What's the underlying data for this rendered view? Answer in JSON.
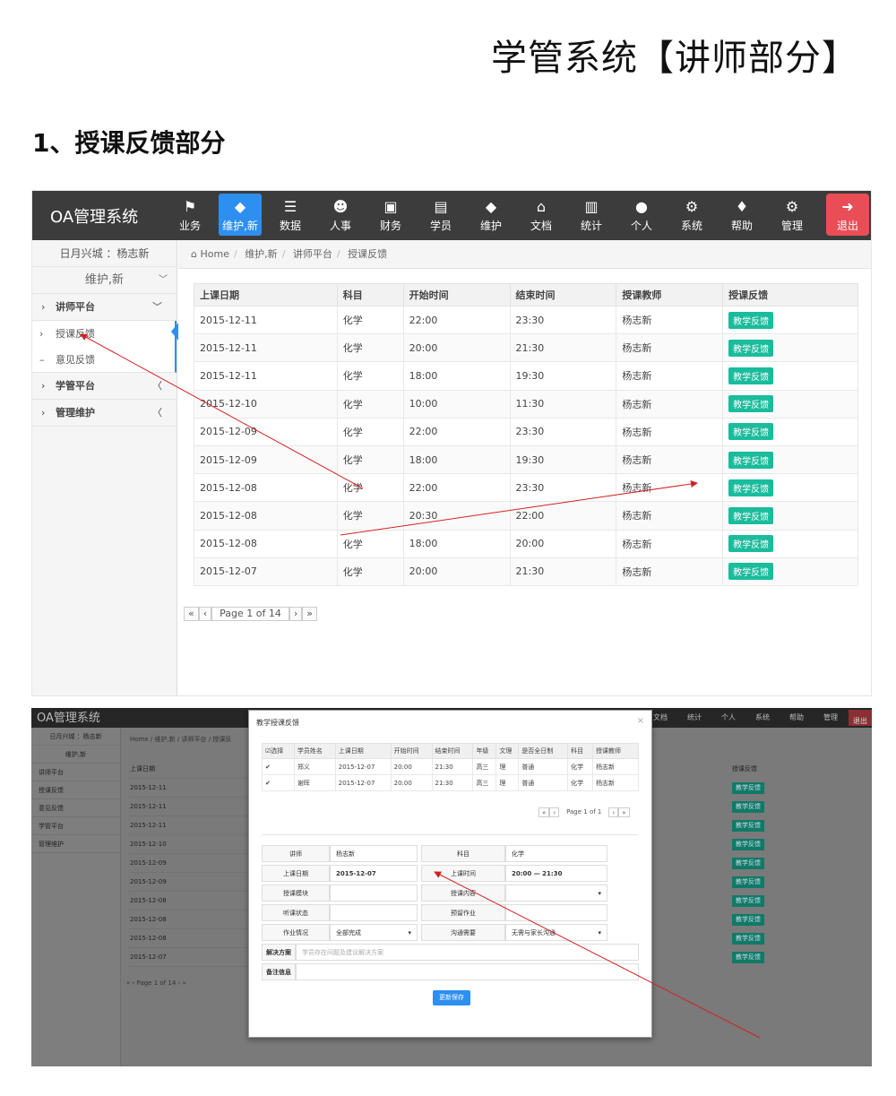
{
  "doc": {
    "title": "学管系统【讲师部分】",
    "section_heading": "1、授课反馈部分"
  },
  "app": {
    "brand": "OA管理系统",
    "nav": [
      {
        "label": "业务",
        "icon": "flag-icon",
        "glyph": "⚑"
      },
      {
        "label": "维护,新",
        "icon": "tag-icon",
        "glyph": "◆"
      },
      {
        "label": "数据",
        "icon": "server-icon",
        "glyph": "☰"
      },
      {
        "label": "人事",
        "icon": "users-icon",
        "glyph": "☻"
      },
      {
        "label": "财务",
        "icon": "money-icon",
        "glyph": "▣"
      },
      {
        "label": "学员",
        "icon": "book-icon",
        "glyph": "▤"
      },
      {
        "label": "维护",
        "icon": "tag-icon",
        "glyph": "◆"
      },
      {
        "label": "文档",
        "icon": "inbox-icon",
        "glyph": "⌂"
      },
      {
        "label": "统计",
        "icon": "bar-chart-icon",
        "glyph": "▥"
      },
      {
        "label": "个人",
        "icon": "user-icon",
        "glyph": "●"
      },
      {
        "label": "系统",
        "icon": "cogs-icon",
        "glyph": "⚙"
      },
      {
        "label": "帮助",
        "icon": "drop-icon",
        "glyph": "♦"
      },
      {
        "label": "管理",
        "icon": "cogs-icon",
        "glyph": "⚙"
      },
      {
        "label": "退出",
        "icon": "sign-out-icon",
        "glyph": "➜"
      }
    ],
    "active_nav": "维护,新",
    "accent_color": "#2d8ff0",
    "exit_color": "#e94e57",
    "feedback_button_color": "#1abc9c",
    "sidebar": {
      "user": "日月兴城 ：杨志新",
      "section": "维护,新",
      "groups": [
        {
          "label": "讲师平台",
          "chevron": "﹀"
        },
        {
          "label": "学管平台",
          "chevron": "〈"
        },
        {
          "label": "管理维护",
          "chevron": "〈"
        }
      ],
      "sub_items": [
        "授课反馈",
        "意见反馈"
      ]
    },
    "breadcrumb": [
      "Home",
      "维护,新",
      "讲师平台",
      "授课反馈"
    ]
  },
  "feedback_table": {
    "headers": [
      "上课日期",
      "科目",
      "开始时间",
      "结束时间",
      "授课教师",
      "授课反馈"
    ],
    "rows": [
      [
        "2015-12-11",
        "化学",
        "22:00",
        "23:30",
        "杨志新",
        "教学反馈"
      ],
      [
        "2015-12-11",
        "化学",
        "20:00",
        "21:30",
        "杨志新",
        "教学反馈"
      ],
      [
        "2015-12-11",
        "化学",
        "18:00",
        "19:30",
        "杨志新",
        "教学反馈"
      ],
      [
        "2015-12-10",
        "化学",
        "10:00",
        "11:30",
        "杨志新",
        "教学反馈"
      ],
      [
        "2015-12-09",
        "化学",
        "22:00",
        "23:30",
        "杨志新",
        "教学反馈"
      ],
      [
        "2015-12-09",
        "化学",
        "18:00",
        "19:30",
        "杨志新",
        "教学反馈"
      ],
      [
        "2015-12-08",
        "化学",
        "22:00",
        "23:30",
        "杨志新",
        "教学反馈"
      ],
      [
        "2015-12-08",
        "化学",
        "20:30",
        "22:00",
        "杨志新",
        "教学反馈"
      ],
      [
        "2015-12-08",
        "化学",
        "18:00",
        "20:00",
        "杨志新",
        "教学反馈"
      ],
      [
        "2015-12-07",
        "化学",
        "20:00",
        "21:30",
        "杨志新",
        "教学反馈"
      ]
    ],
    "pager": {
      "first": "«",
      "prev": "‹",
      "text": "Page 1 of 14",
      "next": "›",
      "last": "»"
    }
  },
  "background_screen": {
    "crumb": "Home / 维护,新 / 讲师平台 / 授课反",
    "side": [
      "日月兴城 ：杨志新",
      "维护,新",
      "讲师平台",
      "授课反馈",
      "意见反馈",
      "学管平台",
      "管理维护"
    ],
    "dates": [
      "上课日期",
      "2015-12-11",
      "2015-12-11",
      "2015-12-11",
      "2015-12-10",
      "2015-12-09",
      "2015-12-09",
      "2015-12-08",
      "2015-12-08",
      "2015-12-08",
      "2015-12-07"
    ],
    "right_header": "授课反馈",
    "nav_right": [
      "文档",
      "统计",
      "个人",
      "系统",
      "帮助",
      "管理",
      "退出"
    ],
    "pager_text": "Page 1 of 14"
  },
  "modal": {
    "title": "教学授课反馈",
    "close": "×",
    "students_table": {
      "headers": [
        "选择",
        "学员姓名",
        "上课日期",
        "开始时间",
        "结束时间",
        "年级",
        "文理",
        "是否全日制",
        "科目",
        "授课教师"
      ],
      "rows": [
        [
          "✔",
          "郑义",
          "2015-12-07",
          "20:00",
          "21:30",
          "高三",
          "理",
          "普通",
          "化学",
          "杨志新"
        ],
        [
          "✔",
          "谢晖",
          "2015-12-07",
          "20:00",
          "21:30",
          "高三",
          "理",
          "普通",
          "化学",
          "杨志新"
        ]
      ]
    },
    "pager_text": "Page 1 of 1",
    "form": {
      "teacher_label": "讲师",
      "teacher_value": "杨志新",
      "subject_label": "科目",
      "subject_value": "化学",
      "date_label": "上课日期",
      "date_value": "2015-12-07",
      "time_label": "上课时间",
      "time_value": "20:00 — 21:30",
      "module_label": "授课模块",
      "module_value": "",
      "content_label": "授课内容",
      "content_value": "",
      "listen_label": "听课状态",
      "listen_value": "",
      "preview_label": "预留作业",
      "preview_value": "",
      "homework_label": "作业情况",
      "homework_value": "全部完成",
      "comm_label": "沟通需要",
      "comm_value": "无需与家长沟通",
      "solution_label": "解决方案",
      "solution_placeholder": "学员存在问题及建议解决方案",
      "remark_label": "备注信息",
      "remark_value": ""
    },
    "save_button": "更新保存"
  }
}
